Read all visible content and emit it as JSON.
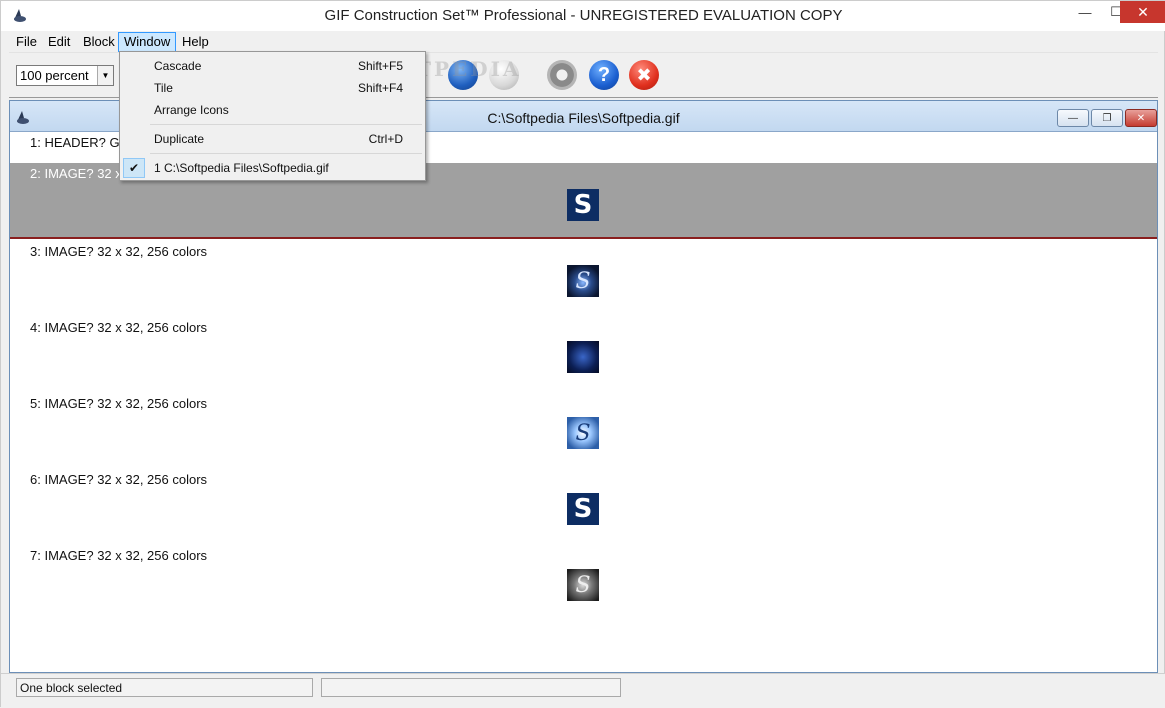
{
  "app": {
    "title": "GIF Construction Set™ Professional - UNREGISTERED EVALUATION COPY"
  },
  "menu": {
    "items": [
      "File",
      "Edit",
      "Block",
      "Window",
      "Help"
    ]
  },
  "toolbar": {
    "zoom_value": "100 percent"
  },
  "watermark": "SOFTPEDIA",
  "window_menu": {
    "items": [
      {
        "label": "Cascade",
        "shortcut": "Shift+F5"
      },
      {
        "label": "Tile",
        "shortcut": "Shift+F4"
      },
      {
        "label": "Arrange Icons",
        "shortcut": ""
      },
      {
        "label": "Duplicate",
        "shortcut": "Ctrl+D"
      },
      {
        "label": "1 C:\\Softpedia Files\\Softpedia.gif",
        "shortcut": ""
      }
    ]
  },
  "document": {
    "title": "C:\\Softpedia Files\\Softpedia.gif",
    "blocks": [
      {
        "label": "1: HEADER? G"
      },
      {
        "label": "2: IMAGE? 32 x"
      },
      {
        "label": "3: IMAGE? 32 x 32, 256 colors"
      },
      {
        "label": "4: IMAGE? 32 x 32, 256 colors"
      },
      {
        "label": "5: IMAGE? 32 x 32, 256 colors"
      },
      {
        "label": "6: IMAGE? 32 x 32, 256 colors"
      },
      {
        "label": "7: IMAGE? 32 x 32, 256 colors"
      }
    ]
  },
  "thumb_letter": "S",
  "status": {
    "panel_1": "One block selected",
    "panel_2": ""
  }
}
